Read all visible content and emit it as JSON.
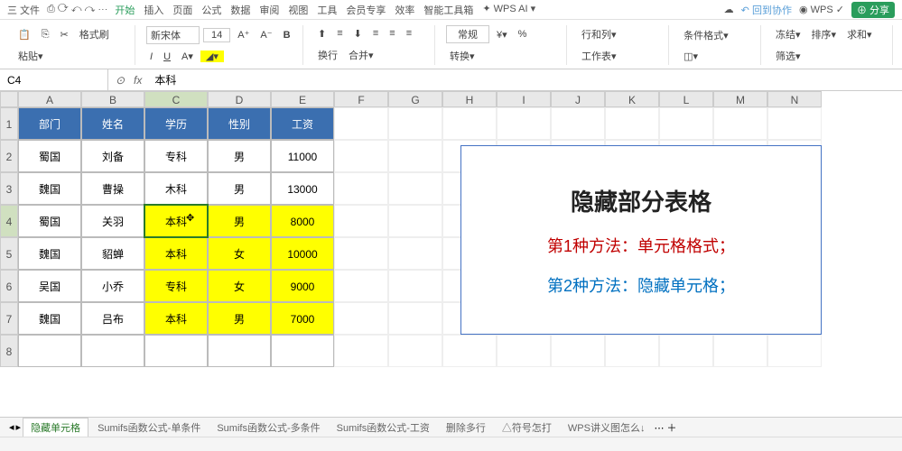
{
  "titlebar": {
    "file": "三 文件",
    "undo": "↶ 回到协作",
    "wps": "◉ WPS ✓",
    "share": "⊕ 分享"
  },
  "menus": [
    "开始",
    "插入",
    "页面",
    "公式",
    "数据",
    "审阅",
    "视图",
    "工具",
    "会员专享",
    "效率",
    "智能工具箱"
  ],
  "ai": "✦ WPS AI ▾",
  "ribbon": {
    "fmt": "格式刷",
    "paste": "粘贴▾",
    "font": "新宋体",
    "size": "14",
    "wrap": "换行",
    "general": "常规",
    "convert": "转换▾",
    "rows": "行和列▾",
    "worksheet": "工作表▾",
    "cond": "条件格式▾",
    "freeze": "冻结▾",
    "sort": "排序▾",
    "sum": "求和▾",
    "filter": "筛选▾",
    "merge": "合并▾"
  },
  "namebox": "C4",
  "formula": "本科",
  "cols": [
    "",
    "A",
    "B",
    "C",
    "D",
    "E",
    "F",
    "G",
    "H",
    "I",
    "J",
    "K",
    "L",
    "M",
    "N"
  ],
  "headers": [
    "部门",
    "姓名",
    "学历",
    "性别",
    "工资"
  ],
  "rows": [
    {
      "n": "2",
      "d": [
        "蜀国",
        "刘备",
        "专科",
        "男",
        "11000"
      ],
      "y": false
    },
    {
      "n": "3",
      "d": [
        "魏国",
        "曹操",
        "木科",
        "男",
        "13000"
      ],
      "y": false
    },
    {
      "n": "4",
      "d": [
        "蜀国",
        "关羽",
        "本科",
        "男",
        "8000"
      ],
      "y": true,
      "sel": true
    },
    {
      "n": "5",
      "d": [
        "魏国",
        "貂蝉",
        "本科",
        "女",
        "10000"
      ],
      "y": true
    },
    {
      "n": "6",
      "d": [
        "吴国",
        "小乔",
        "专科",
        "女",
        "9000"
      ],
      "y": true
    },
    {
      "n": "7",
      "d": [
        "魏国",
        "吕布",
        "本科",
        "男",
        "7000"
      ],
      "y": true
    },
    {
      "n": "8",
      "d": [
        "",
        "",
        "",
        "",
        ""
      ],
      "y": false
    }
  ],
  "info": {
    "t1": "隐藏部分表格",
    "t2": "第1种方法：单元格格式；",
    "t3": "第2种方法：隐藏单元格；"
  },
  "tabs": {
    "active": "隐藏单元格",
    "others": [
      "Sumifs函数公式-单条件",
      "Sumifs函数公式-多条件",
      "Sumifs函数公式-工资",
      "删除多行",
      "△符号怎打",
      "WPS讲义图怎么↓"
    ]
  }
}
